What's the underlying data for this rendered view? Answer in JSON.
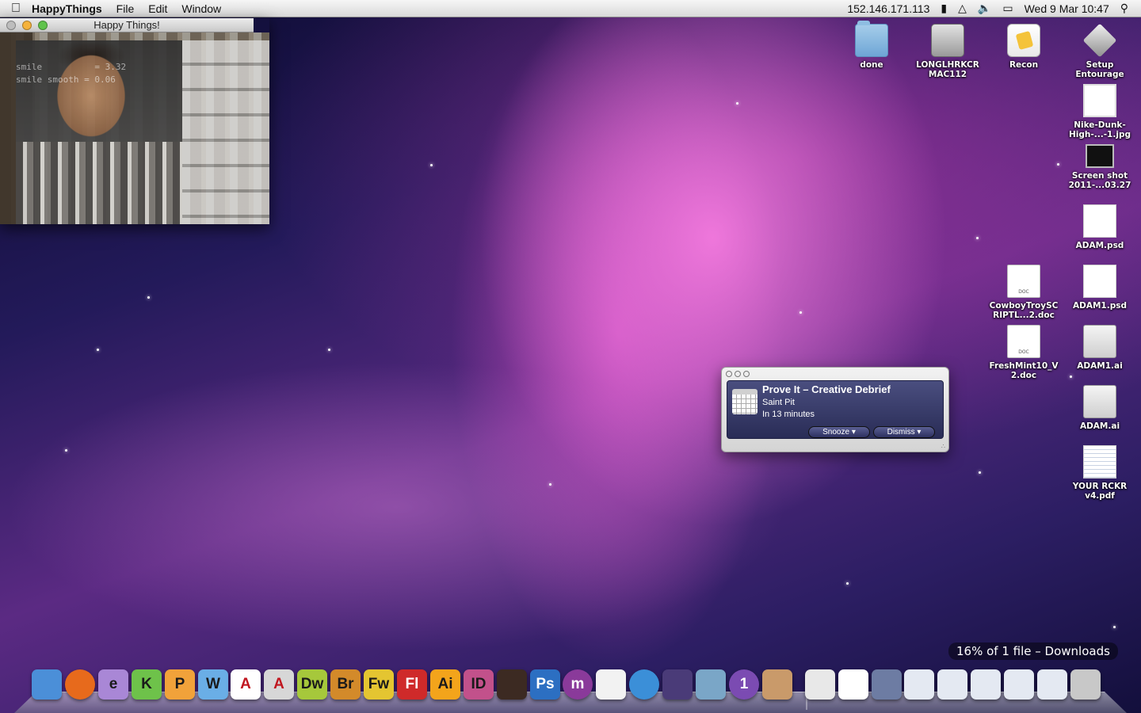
{
  "menubar": {
    "app_name": "HappyThings",
    "menus": [
      "File",
      "Edit",
      "Window"
    ],
    "ip": "152.146.171.113",
    "datetime": "Wed 9 Mar  10:47"
  },
  "window": {
    "title": "Happy Things!",
    "overlay_line1": "smile          = 3.32",
    "overlay_line2": "smile smooth = 0.06"
  },
  "desktop_icons": [
    {
      "label": "done"
    },
    {
      "label": "LONGLHRKCR MAC112"
    },
    {
      "label": "Recon"
    },
    {
      "label": "Setup Entourage"
    },
    {
      "label": "Nike-Dunk-High-...-1.jpg"
    },
    {
      "label": "Screen shot 2011-...03.27"
    },
    {
      "label": "ADAM.psd"
    },
    {
      "label": "CowboyTroySC RIPTL...2.doc"
    },
    {
      "label": "ADAM1.psd"
    },
    {
      "label": "FreshMint10_V 2.doc"
    },
    {
      "label": "ADAM1.ai"
    },
    {
      "label": "ADAM.ai"
    },
    {
      "label": "YOUR RCKR v4.pdf"
    }
  ],
  "alarm": {
    "title": "Prove It – Creative Debrief",
    "location": "Saint Pit",
    "time": "In 13 minutes",
    "snooze_label": "Snooze",
    "dismiss_label": "Dismiss"
  },
  "download_status": "16% of 1 file – Downloads",
  "dock": {
    "items": [
      {
        "name": "finder",
        "text": "",
        "color": "#4b8fd8"
      },
      {
        "name": "firefox",
        "text": "",
        "color": "#e76a1c"
      },
      {
        "name": "expression-e",
        "text": "e",
        "color": "#a987d6"
      },
      {
        "name": "expression-k",
        "text": "K",
        "color": "#6ec24a"
      },
      {
        "name": "expression-p",
        "text": "P",
        "color": "#f1a23a"
      },
      {
        "name": "expression-w",
        "text": "W",
        "color": "#6aaee6"
      },
      {
        "name": "acrobat-reader",
        "text": "A",
        "color": "#ffffff"
      },
      {
        "name": "acrobat-pro",
        "text": "A",
        "color": "#d7d7d7"
      },
      {
        "name": "dreamweaver",
        "text": "Dw",
        "color": "#a6c83b"
      },
      {
        "name": "bridge",
        "text": "Br",
        "color": "#d38a2a"
      },
      {
        "name": "fireworks",
        "text": "Fw",
        "color": "#e4c531"
      },
      {
        "name": "flash",
        "text": "Fl",
        "color": "#cf2a2a"
      },
      {
        "name": "illustrator",
        "text": "Ai",
        "color": "#f3a41b"
      },
      {
        "name": "indesign",
        "text": "ID",
        "color": "#c2518b"
      },
      {
        "name": "film",
        "text": "",
        "color": "#3c2a22"
      },
      {
        "name": "photoshop",
        "text": "Ps",
        "color": "#2c6fc2"
      },
      {
        "name": "metal",
        "text": "m",
        "color": "#8a3a9a"
      },
      {
        "name": "picasa",
        "text": "",
        "color": "#f2f2f2"
      },
      {
        "name": "itunes",
        "text": "",
        "color": "#3b8fd8"
      },
      {
        "name": "dashboard",
        "text": "",
        "color": "#4a3b78"
      },
      {
        "name": "iphoto",
        "text": "",
        "color": "#7aa6c7"
      },
      {
        "name": "alarm-clock",
        "text": "1",
        "color": "#7b4bb2"
      },
      {
        "name": "cat",
        "text": "",
        "color": "#c99a6a"
      },
      {
        "name": "docs",
        "text": "",
        "color": "#e8e8e8"
      },
      {
        "name": "blank-doc",
        "text": "",
        "color": "#ffffff"
      },
      {
        "name": "window-1",
        "text": "",
        "color": "#6d7ca3"
      },
      {
        "name": "window-2",
        "text": "",
        "color": "#e4e9f2"
      },
      {
        "name": "window-3",
        "text": "",
        "color": "#e4e9f2"
      },
      {
        "name": "window-4",
        "text": "",
        "color": "#e4e9f2"
      },
      {
        "name": "window-5",
        "text": "",
        "color": "#e4e9f2"
      },
      {
        "name": "window-6",
        "text": "",
        "color": "#e4e9f2"
      },
      {
        "name": "trash",
        "text": "",
        "color": "#c8c8c8"
      }
    ]
  }
}
